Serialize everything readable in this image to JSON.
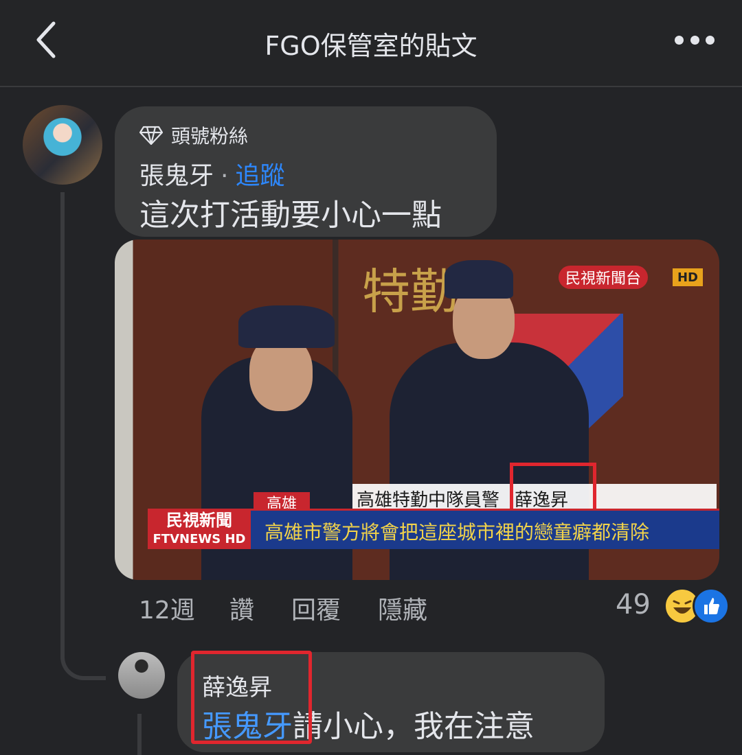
{
  "header": {
    "title": "FGO保管室的貼文",
    "back_icon": "chevron-left-icon",
    "more_icon": "more-horizontal-icon"
  },
  "comment": {
    "badge": "頭號粉絲",
    "badge_icon": "diamond-icon",
    "author": "張鬼牙",
    "separator": "·",
    "follow": "追蹤",
    "text": "這次打活動要小心一點",
    "media": {
      "wall_text": "特勤中",
      "channel": "民視新聞台",
      "hd": "HD",
      "location": "高雄",
      "caption": "高雄特勤中隊員警",
      "caption_name": "薛逸昇",
      "news_logo_line1": "民視新聞",
      "news_logo_line2": "FTVNEWS HD",
      "headline": "高雄市警方將會把這座城市裡的戀童癖都清除"
    },
    "actions": {
      "time": "12週",
      "like": "讚",
      "reply": "回覆",
      "hide": "隱藏"
    },
    "reaction_count": "49",
    "reactions": [
      "haha-emoji",
      "like-emoji"
    ]
  },
  "reply": {
    "author": "薛逸昇",
    "mention": "張鬼牙",
    "text": "請小心，我在注意"
  },
  "colors": {
    "link": "#2d88ff",
    "highlight": "#e0262e",
    "bubble": "#3a3b3c",
    "background": "#232427"
  }
}
